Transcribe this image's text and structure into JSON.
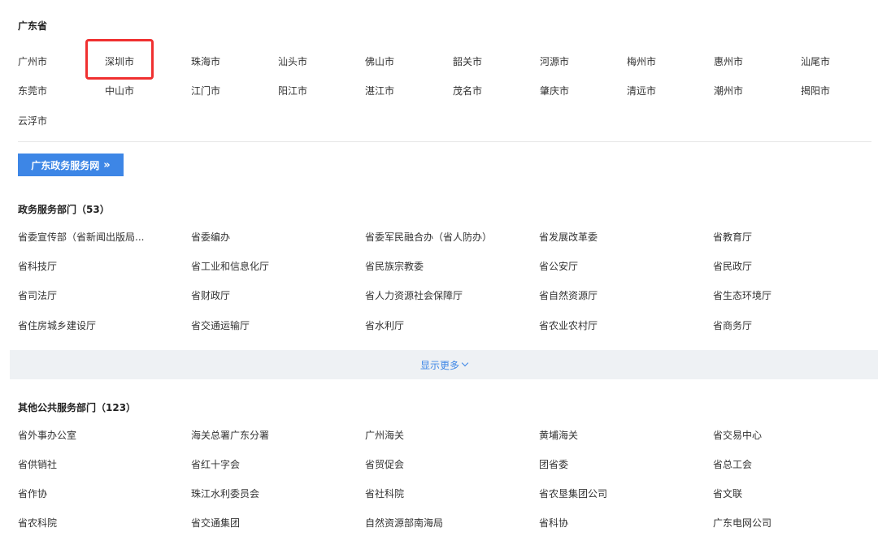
{
  "province": {
    "title": "广东省",
    "cities": [
      "广州市",
      "深圳市",
      "珠海市",
      "汕头市",
      "佛山市",
      "韶关市",
      "河源市",
      "梅州市",
      "惠州市",
      "汕尾市",
      "东莞市",
      "中山市",
      "江门市",
      "阳江市",
      "湛江市",
      "茂名市",
      "肇庆市",
      "清远市",
      "潮州市",
      "揭阳市",
      "云浮市"
    ],
    "highlighted_city": "深圳市",
    "highlight_color": "#f03030"
  },
  "portal_button": {
    "label": "广东政务服务网",
    "arrow": "»",
    "color": "#3d86e6"
  },
  "gov_departments": {
    "title": "政务服务部门（53）",
    "items": [
      "省委宣传部（省新闻出版局...",
      "省委编办",
      "省委军民融合办（省人防办）",
      "省发展改革委",
      "省教育厅",
      "省科技厅",
      "省工业和信息化厅",
      "省民族宗教委",
      "省公安厅",
      "省民政厅",
      "省司法厅",
      "省财政厅",
      "省人力资源社会保障厅",
      "省自然资源厅",
      "省生态环境厅",
      "省住房城乡建设厅",
      "省交通运输厅",
      "省水利厅",
      "省农业农村厅",
      "省商务厅"
    ]
  },
  "show_more": {
    "label": "显示更多",
    "icon": "chevron-down-icon"
  },
  "public_departments": {
    "title": "其他公共服务部门（123）",
    "items": [
      "省外事办公室",
      "海关总署广东分署",
      "广州海关",
      "黄埔海关",
      "省交易中心",
      "省供销社",
      "省红十字会",
      "省贸促会",
      "团省委",
      "省总工会",
      "省作协",
      "珠江水利委员会",
      "省社科院",
      "省农垦集团公司",
      "省文联",
      "省农科院",
      "省交通集团",
      "自然资源部南海局",
      "省科协",
      "广东电网公司"
    ]
  }
}
